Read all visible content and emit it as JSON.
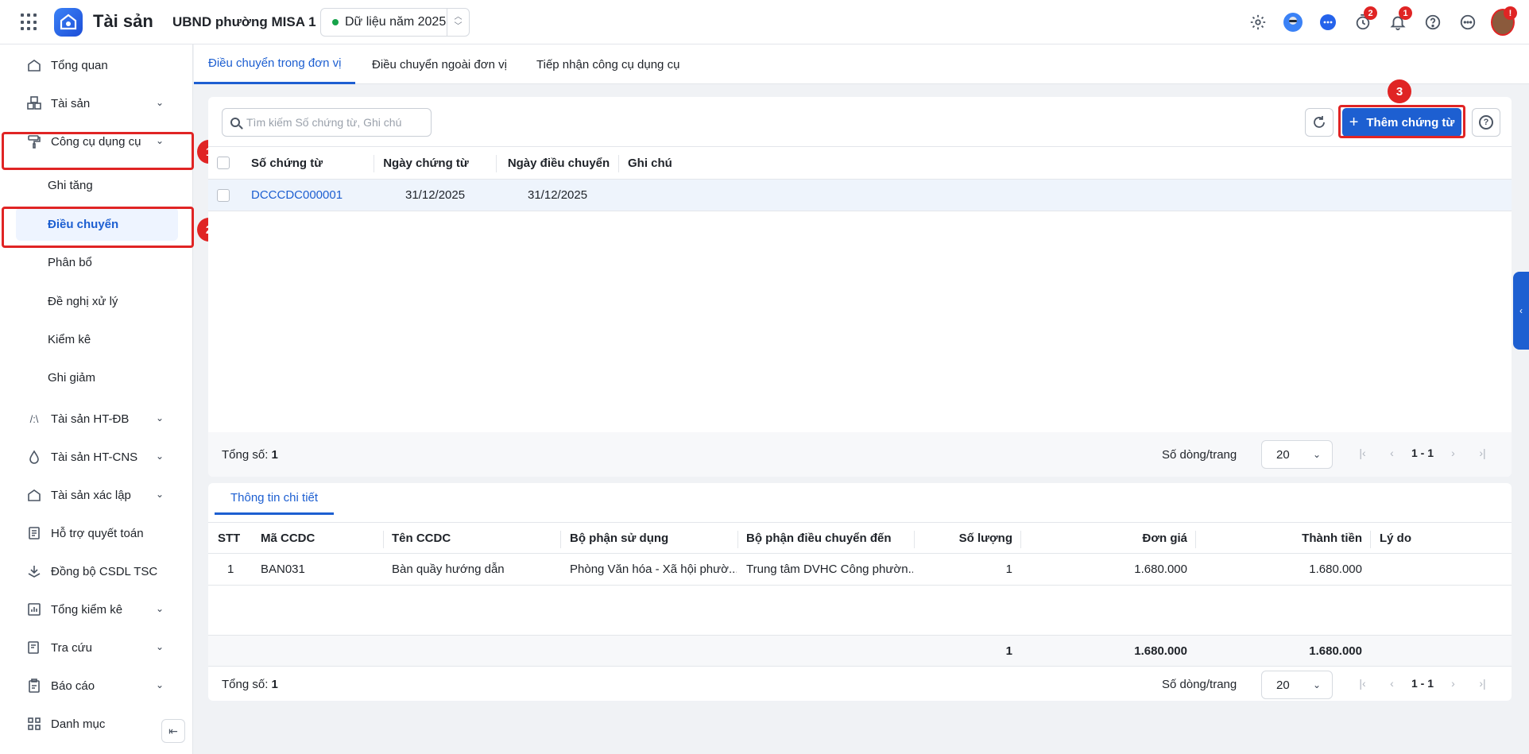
{
  "app": {
    "title": "Tài sản",
    "org": "UBND phường MISA 1",
    "year_label": "Dữ liệu năm 2025"
  },
  "header_badges": {
    "timer": "2",
    "bell": "1",
    "avatar": "!"
  },
  "sidebar": {
    "items": [
      {
        "label": "Tổng quan"
      },
      {
        "label": "Tài sản"
      },
      {
        "label": "Công cụ dụng cụ"
      },
      {
        "label": "Tài sản HT-ĐB"
      },
      {
        "label": "Tài sản HT-CNS"
      },
      {
        "label": "Tài sản xác lập"
      },
      {
        "label": "Hỗ trợ quyết toán"
      },
      {
        "label": "Đồng bộ CSDL TSC"
      },
      {
        "label": "Tổng kiểm kê"
      },
      {
        "label": "Tra cứu"
      },
      {
        "label": "Báo cáo"
      },
      {
        "label": "Danh mục"
      }
    ],
    "sub_items": [
      {
        "label": "Ghi tăng"
      },
      {
        "label": "Điều chuyển"
      },
      {
        "label": "Phân bổ"
      },
      {
        "label": "Đề nghị xử lý"
      },
      {
        "label": "Kiểm kê"
      },
      {
        "label": "Ghi giảm"
      }
    ]
  },
  "annotations": {
    "step1": "1",
    "step2": "2",
    "step3": "3"
  },
  "tabs": [
    {
      "label": "Điều chuyển trong đơn vị"
    },
    {
      "label": "Điều chuyển ngoài đơn vị"
    },
    {
      "label": "Tiếp nhận công cụ dụng cụ"
    }
  ],
  "toolbar": {
    "search_placeholder": "Tìm kiếm Số chứng từ, Ghi chú",
    "add_label": "Thêm chứng từ"
  },
  "main_table": {
    "columns": [
      "Số chứng từ",
      "Ngày chứng từ",
      "Ngày điều chuyển",
      "Ghi chú"
    ],
    "rows": [
      {
        "so_chung_tu": "DCCCDC000001",
        "ngay_chung_tu": "31/12/2025",
        "ngay_dieu_chuyen": "31/12/2025",
        "ghi_chu": ""
      }
    ],
    "total_label": "Tổng số:",
    "total_value": "1",
    "rows_per_page_label": "Số dòng/trang",
    "rows_per_page": "20",
    "range": "1 - 1"
  },
  "detail": {
    "tab_label": "Thông tin chi tiết",
    "columns": [
      "STT",
      "Mã CCDC",
      "Tên CCDC",
      "Bộ phận sử dụng",
      "Bộ phận điều chuyển đến",
      "Số lượng",
      "Đơn giá",
      "Thành tiền",
      "Lý do"
    ],
    "rows": [
      {
        "stt": "1",
        "ma": "BAN031",
        "ten": "Bàn quầy hướng dẫn",
        "bo_phan_su_dung": "Phòng Văn hóa - Xã hội phườ...",
        "bo_phan_den": "Trung tâm DVHC Công phườn...",
        "so_luong": "1",
        "don_gia": "1.680.000",
        "thanh_tien": "1.680.000",
        "ly_do": ""
      }
    ],
    "summary": {
      "so_luong": "1",
      "don_gia": "1.680.000",
      "thanh_tien": "1.680.000"
    },
    "total_label": "Tổng số:",
    "total_value": "1",
    "rows_per_page_label": "Số dòng/trang",
    "rows_per_page": "20",
    "range": "1 - 1"
  }
}
